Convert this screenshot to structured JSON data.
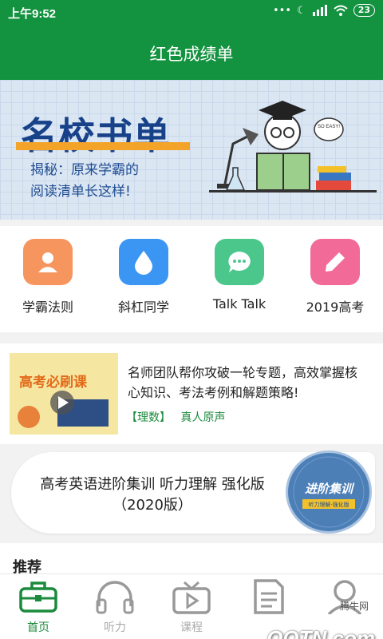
{
  "status": {
    "time": "上午9:52",
    "battery": "23"
  },
  "header": {
    "title": "红色成绩单"
  },
  "banner": {
    "title": "名校书单",
    "subtitle_line1": "揭秘：原来学霸的",
    "subtitle_line2": "阅读清单长这样!",
    "bubble": "SO EASY!"
  },
  "quick_links": [
    {
      "label": "学霸法则",
      "color": "#f7955f"
    },
    {
      "label": "斜杠同学",
      "color": "#3a95f3"
    },
    {
      "label": "Talk Talk",
      "color": "#4cc78c"
    },
    {
      "label": "2019高考",
      "color": "#f26a97"
    }
  ],
  "course": {
    "thumb_title": "高考必刷课",
    "description": "名师团队帮你攻破一轮专题，高效掌握核心知识、考法考例和解题策略!",
    "tag1": "【理数】",
    "tag2": "真人原声"
  },
  "promo": {
    "title": "高考英语进阶集训 听力理解 强化版（2020版）",
    "disc_title": "进阶集训",
    "disc_sub": "听力理解·强化版"
  },
  "recommend": {
    "title": "推荐"
  },
  "nav": [
    {
      "label": "首页",
      "active": true
    },
    {
      "label": "听力",
      "active": false
    },
    {
      "label": "课程",
      "active": false
    },
    {
      "label": "",
      "active": false
    },
    {
      "label": "",
      "active": false
    }
  ],
  "watermark": {
    "text": "QQTN.com",
    "small": "腾牛网"
  },
  "colors": {
    "brand_green": "#13923f",
    "tag_green": "#1c8a3d"
  }
}
